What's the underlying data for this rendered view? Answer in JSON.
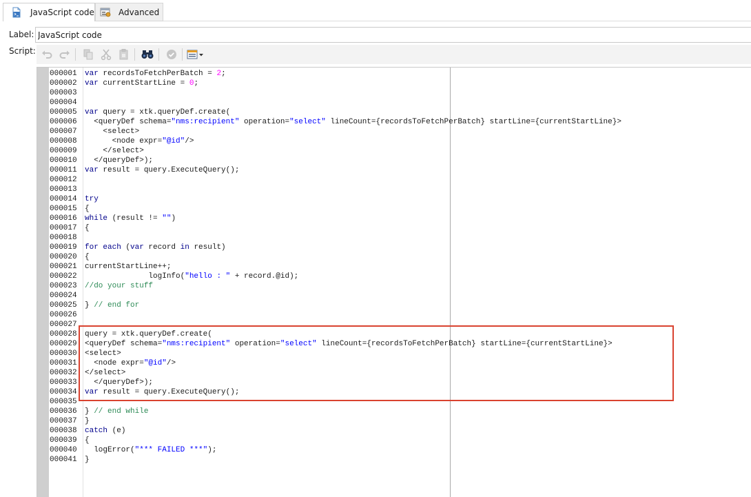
{
  "tabs": [
    {
      "label": "JavaScript code",
      "icon": "javascript-file-icon",
      "active": true
    },
    {
      "label": "Advanced",
      "icon": "settings-window-icon",
      "active": false
    }
  ],
  "form": {
    "label_caption": "Label:",
    "label_value": "JavaScript code",
    "script_caption": "Script:"
  },
  "toolbar": {
    "buttons": [
      "undo-icon",
      "redo-icon",
      "copy-icon",
      "cut-icon",
      "paste-icon",
      "find-icon",
      "check-syntax-icon",
      "insert-menu-icon"
    ]
  },
  "editor": {
    "highlight_color": "#d9422f",
    "lines": [
      [
        [
          "k",
          "var"
        ],
        [
          "t",
          " recordsToFetchPerBatch = "
        ],
        [
          "n",
          "2"
        ],
        [
          "t",
          ";"
        ]
      ],
      [
        [
          "k",
          "var"
        ],
        [
          "t",
          " currentStartLine = "
        ],
        [
          "n",
          "0"
        ],
        [
          "t",
          ";"
        ]
      ],
      [],
      [],
      [
        [
          "k",
          "var"
        ],
        [
          "t",
          " query = xtk.queryDef.create("
        ]
      ],
      [
        [
          "t",
          "  <queryDef schema="
        ],
        [
          "s",
          "\"nms:recipient\""
        ],
        [
          "t",
          " operation="
        ],
        [
          "s",
          "\"select\""
        ],
        [
          "t",
          " lineCount={recordsToFetchPerBatch} startLine={currentStartLine}>"
        ]
      ],
      [
        [
          "t",
          "    <select>"
        ]
      ],
      [
        [
          "t",
          "      <node expr="
        ],
        [
          "s",
          "\"@id\""
        ],
        [
          "t",
          "/>"
        ]
      ],
      [
        [
          "t",
          "    </select>"
        ]
      ],
      [
        [
          "t",
          "  </queryDef>);"
        ]
      ],
      [
        [
          "k",
          "var"
        ],
        [
          "t",
          " result = query.ExecuteQuery();"
        ]
      ],
      [],
      [],
      [
        [
          "k",
          "try"
        ]
      ],
      [
        [
          "t",
          "{"
        ]
      ],
      [
        [
          "k",
          "while"
        ],
        [
          "t",
          " (result != "
        ],
        [
          "s",
          "\"\""
        ],
        [
          "t",
          ")"
        ]
      ],
      [
        [
          "t",
          "{"
        ]
      ],
      [],
      [
        [
          "k",
          "for each"
        ],
        [
          "t",
          " ("
        ],
        [
          "k",
          "var"
        ],
        [
          "t",
          " record "
        ],
        [
          "k",
          "in"
        ],
        [
          "t",
          " result)"
        ]
      ],
      [
        [
          "t",
          "{"
        ]
      ],
      [
        [
          "t",
          "currentStartLine++;"
        ]
      ],
      [
        [
          "t",
          "              logInfo("
        ],
        [
          "s",
          "\"hello : \""
        ],
        [
          "t",
          " + record.@id);"
        ]
      ],
      [
        [
          "c",
          "//do your stuff"
        ]
      ],
      [],
      [
        [
          "t",
          "} "
        ],
        [
          "c",
          "// end for"
        ]
      ],
      [],
      [],
      [
        [
          "t",
          "query = xtk.queryDef.create("
        ]
      ],
      [
        [
          "t",
          "<queryDef schema="
        ],
        [
          "s",
          "\"nms:recipient\""
        ],
        [
          "t",
          " operation="
        ],
        [
          "s",
          "\"select\""
        ],
        [
          "t",
          " lineCount={recordsToFetchPerBatch} startLine={currentStartLine}>"
        ]
      ],
      [
        [
          "t",
          "<select>"
        ]
      ],
      [
        [
          "t",
          "  <node expr="
        ],
        [
          "s",
          "\"@id\""
        ],
        [
          "t",
          "/>"
        ]
      ],
      [
        [
          "t",
          "</select>"
        ]
      ],
      [
        [
          "t",
          "  </queryDef>);"
        ]
      ],
      [
        [
          "k",
          "var"
        ],
        [
          "t",
          " result = query.ExecuteQuery();"
        ]
      ],
      [],
      [
        [
          "t",
          "} "
        ],
        [
          "c",
          "// end while"
        ]
      ],
      [
        [
          "t",
          "}"
        ]
      ],
      [
        [
          "k",
          "catch"
        ],
        [
          "t",
          " (e)"
        ]
      ],
      [
        [
          "t",
          "{"
        ]
      ],
      [
        [
          "t",
          "  logError("
        ],
        [
          "s",
          "\"*** FAILED ***\""
        ],
        [
          "t",
          ");"
        ]
      ],
      [
        [
          "t",
          "}"
        ]
      ]
    ]
  }
}
